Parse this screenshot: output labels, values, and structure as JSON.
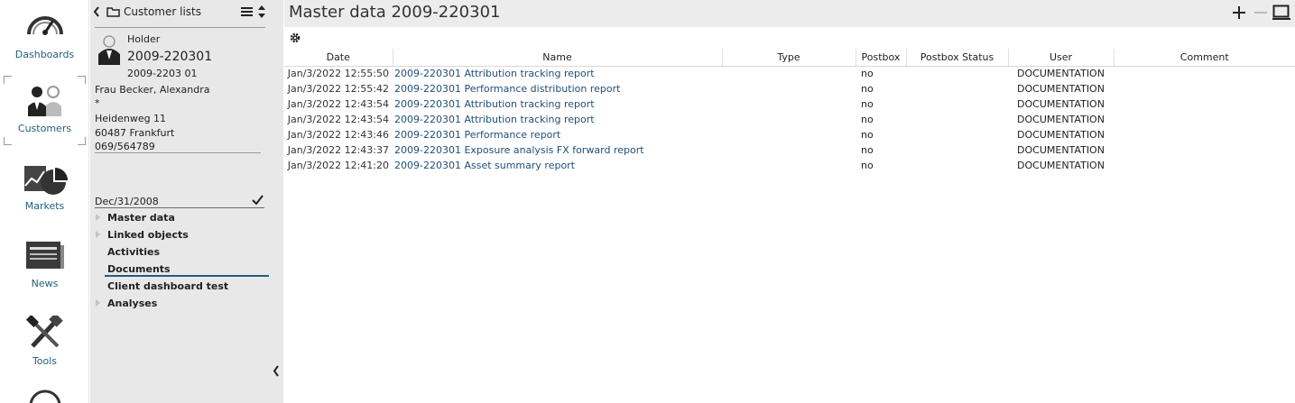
{
  "nav": {
    "items": [
      {
        "label": "Dashboards",
        "icon": "speedometer-icon"
      },
      {
        "label": "Customers",
        "icon": "people-icon"
      },
      {
        "label": "Markets",
        "icon": "chart-icon"
      },
      {
        "label": "News",
        "icon": "newspaper-icon"
      },
      {
        "label": "Tools",
        "icon": "tools-icon"
      }
    ]
  },
  "panel": {
    "header_title": "Customer lists",
    "holder_label": "Holder",
    "account_number": "2009-220301",
    "sub_account": "2009-2203 01",
    "customer_name": "Frau Becker, Alexandra",
    "asterisk": "*",
    "street": "Heidenweg 11",
    "city": "60487 Frankfurt",
    "phone": "069/564789",
    "date": "Dec/31/2008",
    "tree": [
      {
        "label": "Master data",
        "expandable": true
      },
      {
        "label": "Linked objects",
        "expandable": true
      },
      {
        "label": "Activities",
        "expandable": false
      },
      {
        "label": "Documents",
        "expandable": false,
        "selected": true
      },
      {
        "label": "Client dashboard test",
        "expandable": false
      },
      {
        "label": "Analyses",
        "expandable": true
      }
    ]
  },
  "main": {
    "title": "Master data 2009-220301",
    "columns": {
      "date": "Date",
      "name": "Name",
      "type": "Type",
      "postbox": "Postbox",
      "postbox_status": "Postbox Status",
      "user": "User",
      "comment": "Comment"
    },
    "rows": [
      {
        "date": "Jan/3/2022 12:55:50",
        "name": "2009-220301 Attribution tracking report",
        "type": "",
        "postbox": "no",
        "postbox_status": "",
        "user": "DOCUMENTATION",
        "comment": ""
      },
      {
        "date": "Jan/3/2022 12:55:42",
        "name": "2009-220301 Performance distribution report",
        "type": "",
        "postbox": "no",
        "postbox_status": "",
        "user": "DOCUMENTATION",
        "comment": ""
      },
      {
        "date": "Jan/3/2022 12:43:54",
        "name": "2009-220301 Attribution tracking report",
        "type": "",
        "postbox": "no",
        "postbox_status": "",
        "user": "DOCUMENTATION",
        "comment": ""
      },
      {
        "date": "Jan/3/2022 12:43:54",
        "name": "2009-220301 Attribution tracking report",
        "type": "",
        "postbox": "no",
        "postbox_status": "",
        "user": "DOCUMENTATION",
        "comment": ""
      },
      {
        "date": "Jan/3/2022 12:43:46",
        "name": "2009-220301 Performance report",
        "type": "",
        "postbox": "no",
        "postbox_status": "",
        "user": "DOCUMENTATION",
        "comment": ""
      },
      {
        "date": "Jan/3/2022 12:43:37",
        "name": "2009-220301 Exposure analysis FX forward report",
        "type": "",
        "postbox": "no",
        "postbox_status": "",
        "user": "DOCUMENTATION",
        "comment": ""
      },
      {
        "date": "Jan/3/2022 12:41:20",
        "name": "2009-220301 Asset summary report",
        "type": "",
        "postbox": "no",
        "postbox_status": "",
        "user": "DOCUMENTATION",
        "comment": ""
      }
    ]
  },
  "colors": {
    "accent": "#1f5f7a",
    "link": "#1f4f7a",
    "panel_bg": "#e8e8e8",
    "titlebar_bg": "#ececec"
  }
}
